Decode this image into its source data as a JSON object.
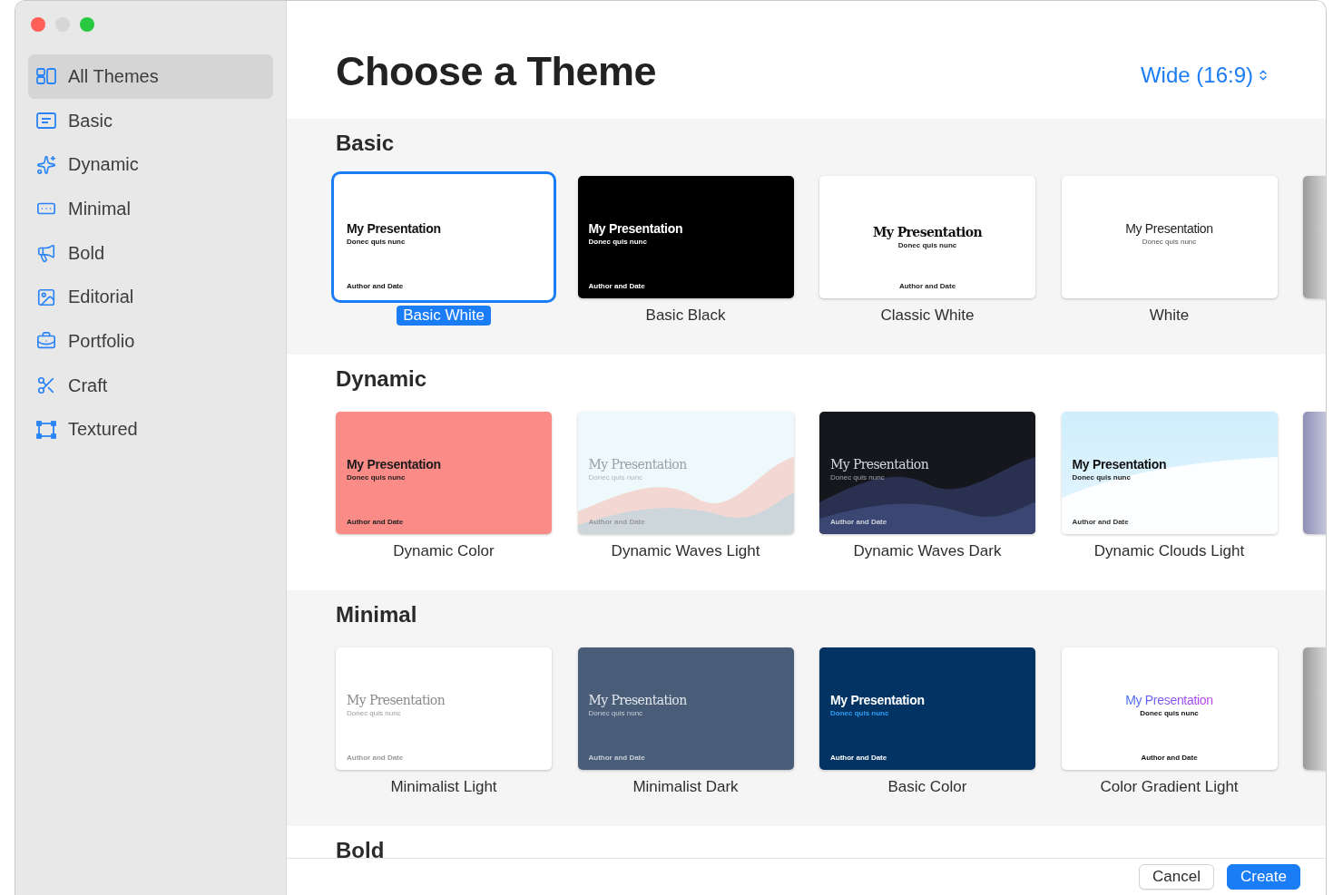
{
  "sidebar": {
    "items": [
      {
        "label": "All Themes",
        "selected": true
      },
      {
        "label": "Basic",
        "selected": false
      },
      {
        "label": "Dynamic",
        "selected": false
      },
      {
        "label": "Minimal",
        "selected": false
      },
      {
        "label": "Bold",
        "selected": false
      },
      {
        "label": "Editorial",
        "selected": false
      },
      {
        "label": "Portfolio",
        "selected": false
      },
      {
        "label": "Craft",
        "selected": false
      },
      {
        "label": "Textured",
        "selected": false
      }
    ]
  },
  "header": {
    "title": "Choose a Theme",
    "size_menu": "Wide (16:9)"
  },
  "sections": [
    {
      "heading": "Basic",
      "next_edge": {
        "kind": "gray"
      },
      "themes": [
        {
          "name": "Basic White",
          "kind": "basic-white",
          "selected": true,
          "slide_title": "My Presentation",
          "slide_subtitle": "Donec quis nunc",
          "slide_footer": "Author and Date"
        },
        {
          "name": "Basic Black",
          "kind": "basic-black",
          "selected": false,
          "slide_title": "My Presentation",
          "slide_subtitle": "Donec quis nunc",
          "slide_footer": "Author and Date"
        },
        {
          "name": "Classic White",
          "kind": "classic-white",
          "selected": false,
          "slide_title": "My Presentation",
          "slide_subtitle": "Donec quis nunc",
          "slide_footer": "Author and Date"
        },
        {
          "name": "White",
          "kind": "white",
          "selected": false,
          "slide_title": "My Presentation",
          "slide_subtitle": "Donec quis nunc"
        }
      ]
    },
    {
      "heading": "Dynamic",
      "next_edge": {
        "kind": "purple"
      },
      "themes": [
        {
          "name": "Dynamic Color",
          "kind": "dynamic-color",
          "selected": false,
          "slide_title": "My Presentation",
          "slide_subtitle": "Donec quis nunc",
          "slide_footer": "Author and Date"
        },
        {
          "name": "Dynamic Waves Light",
          "kind": "waves-light",
          "selected": false,
          "slide_title": "My Presentation",
          "slide_subtitle": "Donec quis nunc",
          "slide_footer": "Author and Date"
        },
        {
          "name": "Dynamic Waves Dark",
          "kind": "waves-dark",
          "selected": false,
          "slide_title": "My Presentation",
          "slide_subtitle": "Donec quis nunc",
          "slide_footer": "Author and Date"
        },
        {
          "name": "Dynamic Clouds Light",
          "kind": "clouds-light",
          "selected": false,
          "slide_title": "My Presentation",
          "slide_subtitle": "Donec quis nunc",
          "slide_footer": "Author and Date"
        }
      ]
    },
    {
      "heading": "Minimal",
      "next_edge": {
        "kind": "gray"
      },
      "themes": [
        {
          "name": "Minimalist Light",
          "kind": "minimalist-light",
          "selected": false,
          "slide_title": "My Presentation",
          "slide_subtitle": "Donec quis nunc",
          "slide_footer": "Author and Date"
        },
        {
          "name": "Minimalist Dark",
          "kind": "minimalist-dark",
          "selected": false,
          "slide_title": "My Presentation",
          "slide_subtitle": "Donec quis nunc",
          "slide_footer": "Author and Date"
        },
        {
          "name": "Basic Color",
          "kind": "basic-color",
          "selected": false,
          "slide_title": "My Presentation",
          "slide_subtitle": "Donec quis nunc",
          "slide_footer": "Author and Date"
        },
        {
          "name": "Color Gradient Light",
          "kind": "color-gradient",
          "selected": false,
          "slide_title": "My Presentation",
          "slide_subtitle": "Donec quis nunc",
          "slide_footer": "Author and Date"
        }
      ]
    },
    {
      "heading": "Bold"
    }
  ],
  "footer": {
    "buttons": [
      {
        "label": "Cancel",
        "kind": "secondary"
      },
      {
        "label": "Create",
        "kind": "primary"
      }
    ]
  }
}
